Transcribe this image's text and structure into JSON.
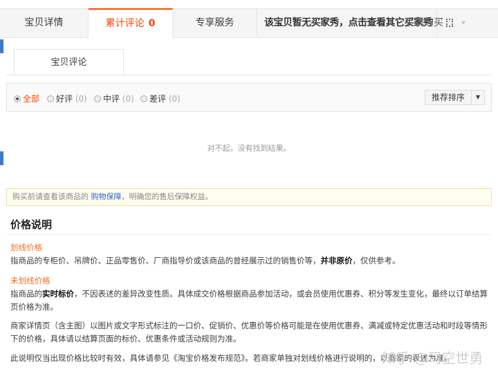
{
  "tabs": {
    "detail": "宝贝详情",
    "reviews": "累计评论",
    "review_count": "0",
    "service": "专享服务",
    "buyer_show": "该宝贝暂无买家秀，点击查看其它买家秀",
    "mobile": "手机购买"
  },
  "subtab": "宝贝评论",
  "filters": [
    {
      "label": "全部",
      "count": ""
    },
    {
      "label": "好评",
      "count": "(0)"
    },
    {
      "label": "中评",
      "count": "(0)"
    },
    {
      "label": "差评",
      "count": "(0)"
    }
  ],
  "sort": {
    "label": "推荐排序"
  },
  "empty": "对不起，没有找到结果。",
  "notice": {
    "pre": "购买前请查看该商品的 ",
    "link": "购物保障",
    "post": "，明确您的售后保障权益。"
  },
  "price": {
    "title": "价格说明",
    "s1_title": "划线价格",
    "s1_a": "指商品的专柜价、吊牌价、正品零售价、厂商指导价或该商品的曾经展示过的销售价等，",
    "s1_b": "并非原价",
    "s1_c": "，仅供参考。",
    "s2_title": "未划线价格",
    "s2_a": "指商品的",
    "s2_b": "实时标价",
    "s2_c": "，不因表述的差异改变性质。具体成交价格根据商品参加活动，或会员使用优惠券、积分等发生变化，最终以订单结算页价格为准。",
    "s3": "商家详情页（含主图）以图片或文字形式标注的一口价、促销价、优惠价等价格可能是在使用优惠券、满减或特定优惠活动和时段等情形下的价格，具体请以结算页面的标价、优惠条件或活动规则为准。",
    "s4": "此说明仅当出现价格比较时有效，具体请参见《淘宝价格发布规范》。若商家单独对划线价格进行说明的，以商家的表述为准。"
  },
  "watermark": "知乎 @司空世勇"
}
